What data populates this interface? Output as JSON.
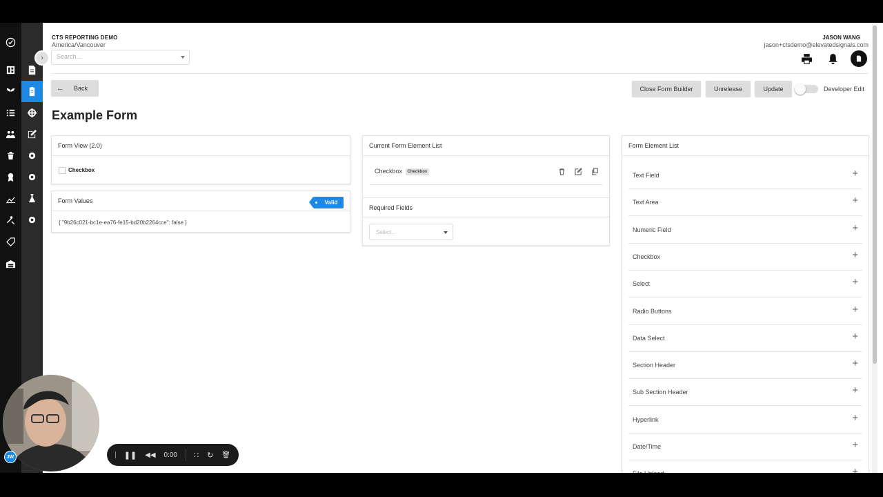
{
  "header": {
    "org_name": "CTS REPORTING DEMO",
    "timezone": "America/Vancouver",
    "search_placeholder": "Search...",
    "user_name": "JASON WANG",
    "user_email": "jason+ctsdemo@elevatedsignals.com"
  },
  "toolbar": {
    "back_label": "Back",
    "close_form_builder_label": "Close Form Builder",
    "unrelease_label": "Unrelease",
    "update_label": "Update",
    "developer_edit_label": "Developer Edit"
  },
  "page": {
    "title": "Example Form"
  },
  "form_view": {
    "title": "Form View (2.0)",
    "checkbox_label": "Checkbox"
  },
  "form_values": {
    "title": "Form Values",
    "status": "Valid",
    "value_text": "{ \"9b26c021-bc1e-ea76-fe15-bd20b2264cce\": false }"
  },
  "current_list": {
    "title": "Current Form Element List",
    "items": [
      {
        "label": "Checkbox",
        "type_pill": "Checkbox"
      }
    ]
  },
  "required_fields": {
    "title": "Required Fields",
    "placeholder": "Select..."
  },
  "element_list": {
    "title": "Form Element List",
    "items": [
      "Text Field",
      "Text Area",
      "Numeric Field",
      "Checkbox",
      "Select",
      "Radio Buttons",
      "Data Select",
      "Section Header",
      "Sub Section Header",
      "Hyperlink",
      "Date/Time",
      "File Upload"
    ]
  },
  "recorder": {
    "time": "0:00",
    "initials": "JW"
  },
  "colors": {
    "accent": "#1e88e5",
    "rail_dark": "#111111",
    "rail_mid": "#2b2b2b"
  }
}
